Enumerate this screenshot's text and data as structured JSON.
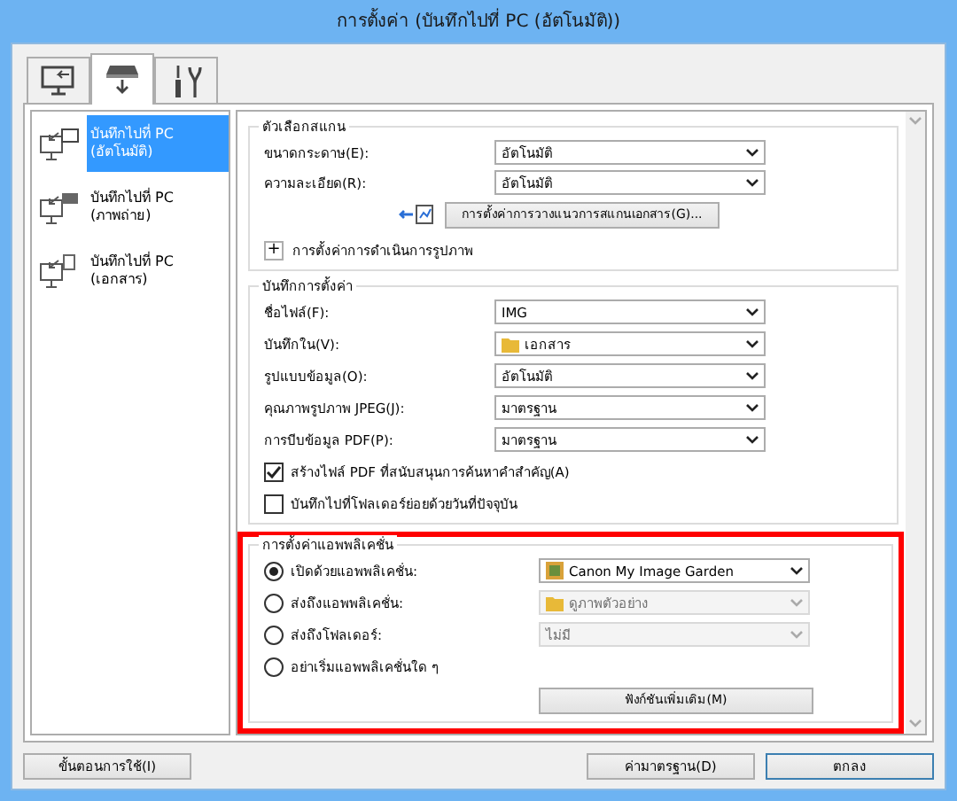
{
  "window": {
    "title": "การตั้งค่า (บันทึกไปที่ PC (อัตโนมัติ))"
  },
  "tabs": [
    {
      "kind": "computer",
      "selected": false
    },
    {
      "kind": "scanner",
      "selected": true
    },
    {
      "kind": "tools",
      "selected": false
    }
  ],
  "sidebar": {
    "items": [
      {
        "label": "บันทึกไปที่ PC\n(อัตโนมัติ)",
        "kind": "auto",
        "selected": true
      },
      {
        "label": "บันทึกไปที่ PC\n(ภาพถ่าย)",
        "kind": "photo",
        "selected": false
      },
      {
        "label": "บันทึกไปที่ PC\n(เอกสาร)",
        "kind": "document",
        "selected": false
      }
    ]
  },
  "scan_options": {
    "title": "ตัวเลือกสแกน",
    "rows": [
      {
        "label": "ขนาดกระดาษ(E):",
        "value": "อัตโนมัติ"
      },
      {
        "label": "ความละเอียด(R):",
        "value": "อัตโนมัติ"
      }
    ],
    "button": "การตั้งค่าการวางแนวการสแกนเอกสาร(G)...",
    "expander": {
      "symbol": "+",
      "label": "การตั้งค่าการดำเนินการรูปภาพ"
    }
  },
  "save_settings": {
    "title": "บันทึกการตั้งค่า",
    "rows": [
      {
        "label": "ชื่อไฟล์(F):",
        "value": "IMG"
      },
      {
        "label": "บันทึกใน(V):",
        "value": "เอกสาร",
        "kind": "folder"
      },
      {
        "label": "รูปแบบข้อมูล(O):",
        "value": "อัตโนมัติ"
      },
      {
        "label": "คุณภาพรูปภาพ JPEG(J):",
        "value": "มาตรฐาน"
      },
      {
        "label": "การบีบข้อมูล PDF(P):",
        "value": "มาตรฐาน"
      }
    ],
    "checkboxes": [
      {
        "label": "สร้างไฟล์ PDF ที่สนับสนุนการค้นหาคำสำคัญ(A)",
        "checked": true
      },
      {
        "label": "บันทึกไปที่โฟลเดอร์ย่อยด้วยวันที่ปัจจุบัน",
        "checked": false
      }
    ]
  },
  "app_settings": {
    "title": "การตั้งค่าแอพพลิเคชั่น",
    "options": [
      {
        "label": "เปิดด้วยแอพพลิเคชั่น:",
        "selected": true,
        "value": "Canon My Image Garden",
        "kind": "app",
        "disabled": false
      },
      {
        "label": "ส่งถึงแอพพลิเคชั่น:",
        "selected": false,
        "value": "ดูภาพตัวอย่าง",
        "kind": "folder",
        "disabled": true
      },
      {
        "label": "ส่งถึงโฟลเดอร์:",
        "selected": false,
        "value": "ไม่มี",
        "disabled": true
      },
      {
        "label": "อย่าเริ่มแอพพลิเคชั่นใด ๆ",
        "selected": false
      }
    ],
    "button": "ฟังก์ชันเพิ่มเติม(M)"
  },
  "footer": {
    "buttons": [
      {
        "label": "ขั้นตอนการใช้(I)",
        "kind": "left"
      },
      {
        "label": "ค่ามาตรฐาน(D)",
        "kind": "right"
      },
      {
        "label": "ตกลง",
        "kind": "primary"
      }
    ]
  }
}
